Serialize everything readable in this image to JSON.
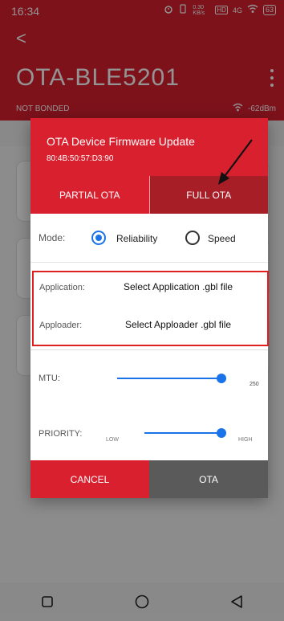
{
  "status_bar": {
    "time": "16:34",
    "speed": "0.30 KB/s",
    "network": "4G",
    "battery": "63"
  },
  "app": {
    "back": "<",
    "device_name": "OTA-BLE5201",
    "bond_status": "NOT BONDED",
    "rssi": "-62dBm",
    "header_color": "#d8202f"
  },
  "dialog": {
    "title": "OTA Device Firmware Update",
    "address": "80:4B:50:57:D3:90",
    "tabs": {
      "partial": "PARTIAL OTA",
      "full": "FULL OTA",
      "selected": "full"
    },
    "mode": {
      "label": "Mode:",
      "options": [
        {
          "label": "Reliability",
          "checked": true
        },
        {
          "label": "Speed",
          "checked": false
        }
      ]
    },
    "files": {
      "application": {
        "label": "Application:",
        "button": "Select Application .gbl file"
      },
      "apploader": {
        "label": "Apploader:",
        "button": "Select Apploader .gbl file"
      }
    },
    "mtu": {
      "label": "MTU:",
      "value": "250",
      "fraction": 0.95
    },
    "priority": {
      "label": "PRIORITY:",
      "low": "LOW",
      "high": "HIGH",
      "fraction": 1.0
    },
    "buttons": {
      "cancel": "CANCEL",
      "ota": "OTA"
    }
  },
  "colors": {
    "brand_red": "#d8202f",
    "dark_red": "#a81e27",
    "accent_blue": "#1a73e8",
    "ota_button_gray": "#5a5a5a"
  }
}
